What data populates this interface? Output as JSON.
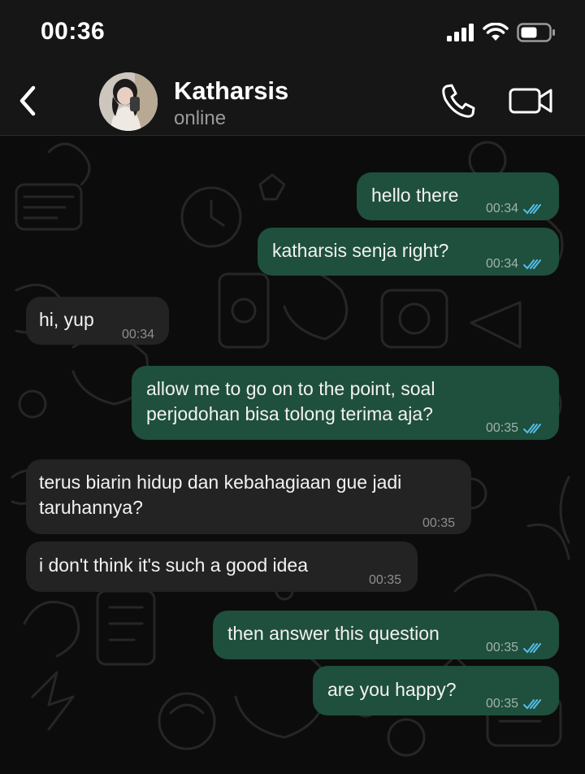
{
  "status_bar": {
    "time": "00:36"
  },
  "header": {
    "contact_name": "Katharsis",
    "contact_status": "online"
  },
  "messages": [
    {
      "direction": "out",
      "text": "hello there",
      "time": "00:34",
      "read": true
    },
    {
      "direction": "out",
      "text": "katharsis senja right?",
      "time": "00:34",
      "read": true
    },
    {
      "direction": "in",
      "text": "hi, yup",
      "time": "00:34"
    },
    {
      "direction": "out",
      "lines": [
        "allow me to go on to the point, soal",
        "perjodohan bisa tolong terima aja?"
      ],
      "time": "00:35",
      "read": true
    },
    {
      "direction": "in",
      "lines": [
        "terus biarin hidup dan kebahagiaan gue jadi",
        "taruhannya?"
      ],
      "time": "00:35"
    },
    {
      "direction": "in",
      "text": "i don't think it's such a good idea",
      "time": "00:35"
    },
    {
      "direction": "out",
      "text": "then answer this question",
      "time": "00:35",
      "read": true
    },
    {
      "direction": "out",
      "text": "are you happy?",
      "time": "00:35",
      "read": true
    }
  ],
  "colors": {
    "outgoing_bubble": "#1f4f3d",
    "incoming_bubble": "#232323",
    "read_tick": "#53bdeb",
    "header_bg": "#161616"
  },
  "icons": {
    "back": "chevron-left-icon",
    "call": "phone-icon",
    "video": "video-camera-icon",
    "signal": "signal-icon",
    "wifi": "wifi-icon",
    "battery": "battery-icon"
  }
}
